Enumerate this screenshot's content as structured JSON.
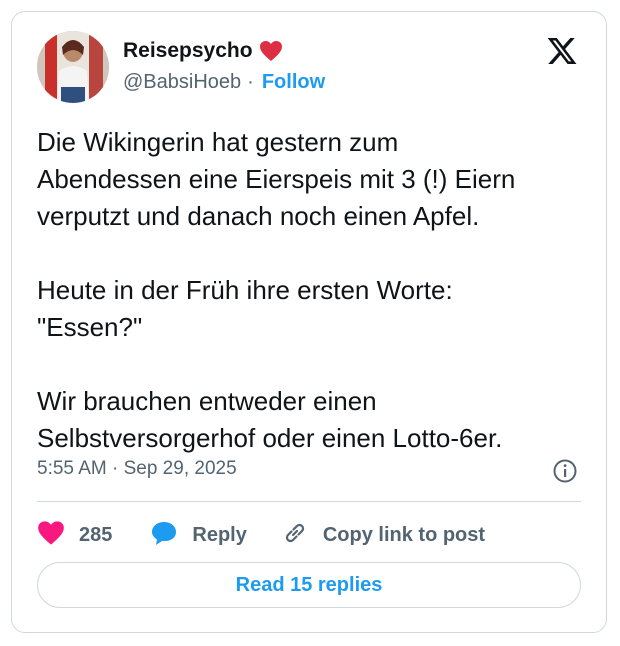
{
  "author": {
    "display_name": "Reisepsycho",
    "handle": "@BabsiHoeb",
    "separator": "·",
    "follow_label": "Follow",
    "name_emoji": "red-heart-icon"
  },
  "tweet": {
    "text": "Die Wikingerin hat gestern zum\nAbendessen eine Eierspeis mit 3 (!) Eiern\nverputzt und danach noch einen Apfel.\n\nHeute in der Früh ihre ersten Worte:\n\"Essen?\"\n\nWir brauchen entweder einen\nSelbstversorgerhof oder einen Lotto-6er.",
    "timestamp": "5:55 AM · Sep 29, 2025"
  },
  "actions": {
    "like_count": "285",
    "reply_label": "Reply",
    "copy_label": "Copy link to post",
    "read_replies_label": "Read 15 replies"
  },
  "colors": {
    "accent": "#1d9bf0",
    "like": "#f91880",
    "text": "#0f1419",
    "muted": "#536471",
    "border": "#cfd9de"
  }
}
